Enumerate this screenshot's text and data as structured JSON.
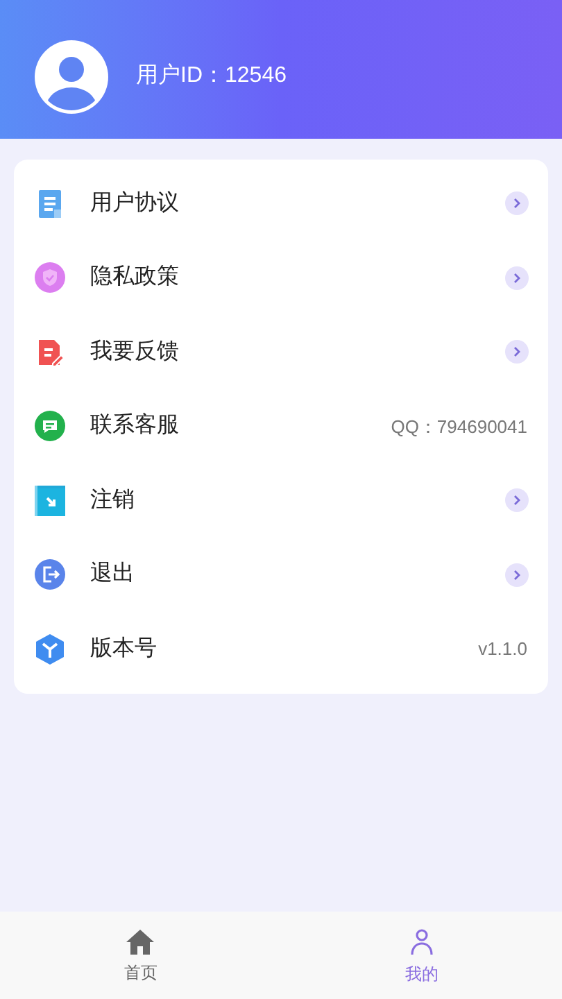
{
  "header": {
    "user_id": "用户ID：12546"
  },
  "menu": [
    {
      "label": "用户协议",
      "kind": "link"
    },
    {
      "label": "隐私政策",
      "kind": "link"
    },
    {
      "label": "我要反馈",
      "kind": "link"
    },
    {
      "label": "联系客服",
      "kind": "value",
      "value": "QQ：794690041"
    },
    {
      "label": "注销",
      "kind": "link"
    },
    {
      "label": "退出",
      "kind": "link"
    },
    {
      "label": "版本号",
      "kind": "value",
      "value": "v1.1.0"
    }
  ],
  "tab_bar": [
    {
      "label": "首页",
      "selected": false
    },
    {
      "label": "我的",
      "selected": true
    }
  ]
}
